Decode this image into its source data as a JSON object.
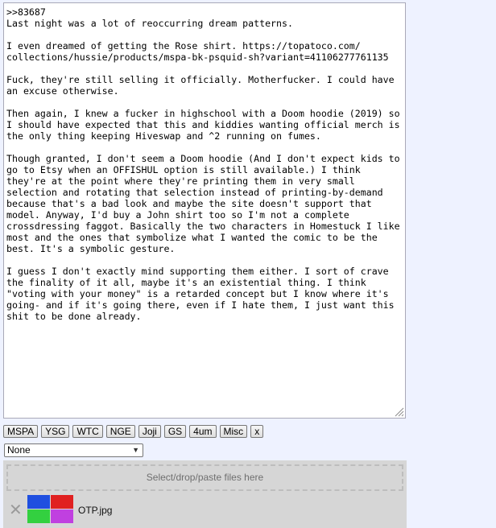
{
  "post": {
    "text": ">>83687\nLast night was a lot of reoccurring dream patterns.\n\nI even dreamed of getting the Rose shirt. https://topatoco.com/\ncollections/hussie/products/mspa-bk-psquid-sh?variant=41106277761135\n\nFuck, they're still selling it officially. Motherfucker. I could have\nan excuse otherwise.\n\nThen again, I knew a fucker in highschool with a Doom hoodie (2019) so\nI should have expected that this and kiddies wanting official merch is\nthe only thing keeping Hiveswap and ^2 running on fumes.\n\nThough granted, I don't seem a Doom hoodie (And I don't expect kids to\ngo to Etsy when an OFFISHUL option is still available.) I think\nthey're at the point where they're printing them in very small\nselection and rotating that selection instead of printing-by-demand\nbecause that's a bad look and maybe the site doesn't support that\nmodel. Anyway, I'd buy a John shirt too so I'm not a complete\ncrossdressing faggot. Basically the two characters in Homestuck I like\nmost and the ones that symbolize what I wanted the comic to be the\nbest. It's a symbolic gesture.\n\nI guess I don't exactly mind supporting them either. I sort of crave\nthe finality of it all, maybe it's an existential thing. I think\n\"voting with your money\" is a retarded concept but I know where it's\ngoing- and if it's going there, even if I hate them, I just want this\nshit to be done already."
  },
  "tags": [
    {
      "label": "MSPA"
    },
    {
      "label": "YSG"
    },
    {
      "label": "WTC"
    },
    {
      "label": "NGE"
    },
    {
      "label": "Joji"
    },
    {
      "label": "GS"
    },
    {
      "label": "4um"
    },
    {
      "label": "Misc"
    },
    {
      "label": "x"
    }
  ],
  "select": {
    "value": "None"
  },
  "upload": {
    "dropzone_label": "Select/drop/paste files here",
    "file": {
      "name": "OTP.jpg",
      "thumb_colors": [
        "#1f4fe0",
        "#e02020",
        "#33d040",
        "#c040e0"
      ]
    }
  },
  "colors": {
    "background": "#eef2ff",
    "panel": "#d6d6d6"
  }
}
